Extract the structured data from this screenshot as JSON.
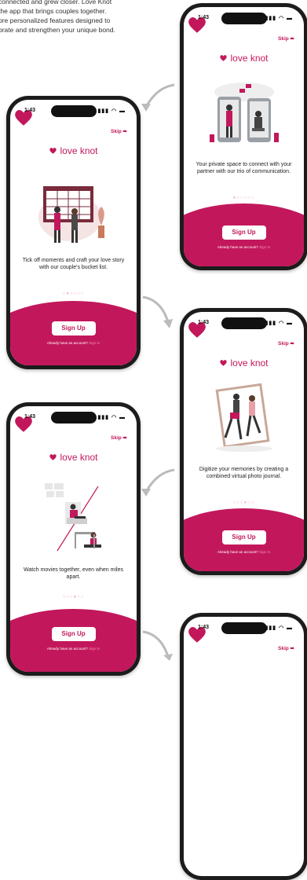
{
  "intro": {
    "lines": [
      "connected and grew closer. Love Knot",
      "the app that brings couples together.",
      "ore personalized features designed to",
      "brate and strengthen your unique bond."
    ]
  },
  "common": {
    "time": "1:43",
    "status_icons": "▮▮▮ ◠ ▬",
    "skip": "Skip ➠",
    "logo": "love knot",
    "signup": "Sign Up",
    "already": "Already have an account?",
    "signin": "Sign In"
  },
  "phones": [
    {
      "caption": "Your private space to connect with your partner with our trio of communication.",
      "dots": "●○○○○○"
    },
    {
      "caption": "Tick off moments and craft your love story with our couple's bucket list.",
      "dots": "○●○○○○"
    },
    {
      "caption": "Digitize your memories by creating a combined virtual photo journal.",
      "dots": "○○○●○○"
    },
    {
      "caption": "Watch movies together, even when miles apart.",
      "dots": "○○○●○○"
    }
  ],
  "colors": {
    "brand": "#c2185b",
    "frame": "#1c1c1c"
  },
  "icons": [
    "heart-icon",
    "arrow-icon"
  ]
}
